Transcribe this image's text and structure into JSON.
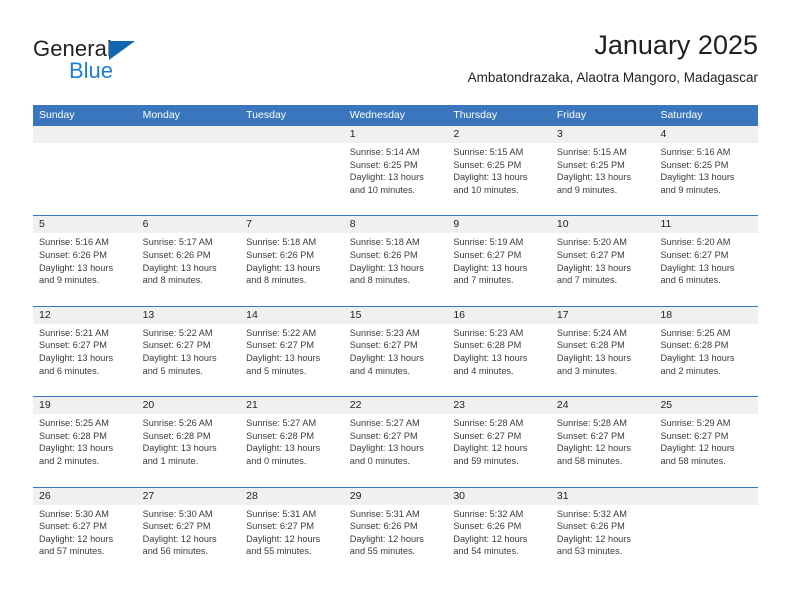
{
  "brand": {
    "name_part1": "General",
    "name_part2": "Blue"
  },
  "header": {
    "title": "January 2025",
    "subtitle": "Ambatondrazaka, Alaotra Mangoro, Madagascar"
  },
  "colors": {
    "header_blue": "#3a76bd",
    "daynum_band": "#f0f0f0",
    "logo_blue": "#1c7fd6",
    "text": "#231f20"
  },
  "weekdays": [
    "Sunday",
    "Monday",
    "Tuesday",
    "Wednesday",
    "Thursday",
    "Friday",
    "Saturday"
  ],
  "weeks": [
    [
      {
        "day": "",
        "l1": "",
        "l2": "",
        "l3": "",
        "l4": ""
      },
      {
        "day": "",
        "l1": "",
        "l2": "",
        "l3": "",
        "l4": ""
      },
      {
        "day": "",
        "l1": "",
        "l2": "",
        "l3": "",
        "l4": ""
      },
      {
        "day": "1",
        "l1": "Sunrise: 5:14 AM",
        "l2": "Sunset: 6:25 PM",
        "l3": "Daylight: 13 hours",
        "l4": "and 10 minutes."
      },
      {
        "day": "2",
        "l1": "Sunrise: 5:15 AM",
        "l2": "Sunset: 6:25 PM",
        "l3": "Daylight: 13 hours",
        "l4": "and 10 minutes."
      },
      {
        "day": "3",
        "l1": "Sunrise: 5:15 AM",
        "l2": "Sunset: 6:25 PM",
        "l3": "Daylight: 13 hours",
        "l4": "and 9 minutes."
      },
      {
        "day": "4",
        "l1": "Sunrise: 5:16 AM",
        "l2": "Sunset: 6:25 PM",
        "l3": "Daylight: 13 hours",
        "l4": "and 9 minutes."
      }
    ],
    [
      {
        "day": "5",
        "l1": "Sunrise: 5:16 AM",
        "l2": "Sunset: 6:26 PM",
        "l3": "Daylight: 13 hours",
        "l4": "and 9 minutes."
      },
      {
        "day": "6",
        "l1": "Sunrise: 5:17 AM",
        "l2": "Sunset: 6:26 PM",
        "l3": "Daylight: 13 hours",
        "l4": "and 8 minutes."
      },
      {
        "day": "7",
        "l1": "Sunrise: 5:18 AM",
        "l2": "Sunset: 6:26 PM",
        "l3": "Daylight: 13 hours",
        "l4": "and 8 minutes."
      },
      {
        "day": "8",
        "l1": "Sunrise: 5:18 AM",
        "l2": "Sunset: 6:26 PM",
        "l3": "Daylight: 13 hours",
        "l4": "and 8 minutes."
      },
      {
        "day": "9",
        "l1": "Sunrise: 5:19 AM",
        "l2": "Sunset: 6:27 PM",
        "l3": "Daylight: 13 hours",
        "l4": "and 7 minutes."
      },
      {
        "day": "10",
        "l1": "Sunrise: 5:20 AM",
        "l2": "Sunset: 6:27 PM",
        "l3": "Daylight: 13 hours",
        "l4": "and 7 minutes."
      },
      {
        "day": "11",
        "l1": "Sunrise: 5:20 AM",
        "l2": "Sunset: 6:27 PM",
        "l3": "Daylight: 13 hours",
        "l4": "and 6 minutes."
      }
    ],
    [
      {
        "day": "12",
        "l1": "Sunrise: 5:21 AM",
        "l2": "Sunset: 6:27 PM",
        "l3": "Daylight: 13 hours",
        "l4": "and 6 minutes."
      },
      {
        "day": "13",
        "l1": "Sunrise: 5:22 AM",
        "l2": "Sunset: 6:27 PM",
        "l3": "Daylight: 13 hours",
        "l4": "and 5 minutes."
      },
      {
        "day": "14",
        "l1": "Sunrise: 5:22 AM",
        "l2": "Sunset: 6:27 PM",
        "l3": "Daylight: 13 hours",
        "l4": "and 5 minutes."
      },
      {
        "day": "15",
        "l1": "Sunrise: 5:23 AM",
        "l2": "Sunset: 6:27 PM",
        "l3": "Daylight: 13 hours",
        "l4": "and 4 minutes."
      },
      {
        "day": "16",
        "l1": "Sunrise: 5:23 AM",
        "l2": "Sunset: 6:28 PM",
        "l3": "Daylight: 13 hours",
        "l4": "and 4 minutes."
      },
      {
        "day": "17",
        "l1": "Sunrise: 5:24 AM",
        "l2": "Sunset: 6:28 PM",
        "l3": "Daylight: 13 hours",
        "l4": "and 3 minutes."
      },
      {
        "day": "18",
        "l1": "Sunrise: 5:25 AM",
        "l2": "Sunset: 6:28 PM",
        "l3": "Daylight: 13 hours",
        "l4": "and 2 minutes."
      }
    ],
    [
      {
        "day": "19",
        "l1": "Sunrise: 5:25 AM",
        "l2": "Sunset: 6:28 PM",
        "l3": "Daylight: 13 hours",
        "l4": "and 2 minutes."
      },
      {
        "day": "20",
        "l1": "Sunrise: 5:26 AM",
        "l2": "Sunset: 6:28 PM",
        "l3": "Daylight: 13 hours",
        "l4": "and 1 minute."
      },
      {
        "day": "21",
        "l1": "Sunrise: 5:27 AM",
        "l2": "Sunset: 6:28 PM",
        "l3": "Daylight: 13 hours",
        "l4": "and 0 minutes."
      },
      {
        "day": "22",
        "l1": "Sunrise: 5:27 AM",
        "l2": "Sunset: 6:27 PM",
        "l3": "Daylight: 13 hours",
        "l4": "and 0 minutes."
      },
      {
        "day": "23",
        "l1": "Sunrise: 5:28 AM",
        "l2": "Sunset: 6:27 PM",
        "l3": "Daylight: 12 hours",
        "l4": "and 59 minutes."
      },
      {
        "day": "24",
        "l1": "Sunrise: 5:28 AM",
        "l2": "Sunset: 6:27 PM",
        "l3": "Daylight: 12 hours",
        "l4": "and 58 minutes."
      },
      {
        "day": "25",
        "l1": "Sunrise: 5:29 AM",
        "l2": "Sunset: 6:27 PM",
        "l3": "Daylight: 12 hours",
        "l4": "and 58 minutes."
      }
    ],
    [
      {
        "day": "26",
        "l1": "Sunrise: 5:30 AM",
        "l2": "Sunset: 6:27 PM",
        "l3": "Daylight: 12 hours",
        "l4": "and 57 minutes."
      },
      {
        "day": "27",
        "l1": "Sunrise: 5:30 AM",
        "l2": "Sunset: 6:27 PM",
        "l3": "Daylight: 12 hours",
        "l4": "and 56 minutes."
      },
      {
        "day": "28",
        "l1": "Sunrise: 5:31 AM",
        "l2": "Sunset: 6:27 PM",
        "l3": "Daylight: 12 hours",
        "l4": "and 55 minutes."
      },
      {
        "day": "29",
        "l1": "Sunrise: 5:31 AM",
        "l2": "Sunset: 6:26 PM",
        "l3": "Daylight: 12 hours",
        "l4": "and 55 minutes."
      },
      {
        "day": "30",
        "l1": "Sunrise: 5:32 AM",
        "l2": "Sunset: 6:26 PM",
        "l3": "Daylight: 12 hours",
        "l4": "and 54 minutes."
      },
      {
        "day": "31",
        "l1": "Sunrise: 5:32 AM",
        "l2": "Sunset: 6:26 PM",
        "l3": "Daylight: 12 hours",
        "l4": "and 53 minutes."
      },
      {
        "day": "",
        "l1": "",
        "l2": "",
        "l3": "",
        "l4": ""
      }
    ]
  ]
}
